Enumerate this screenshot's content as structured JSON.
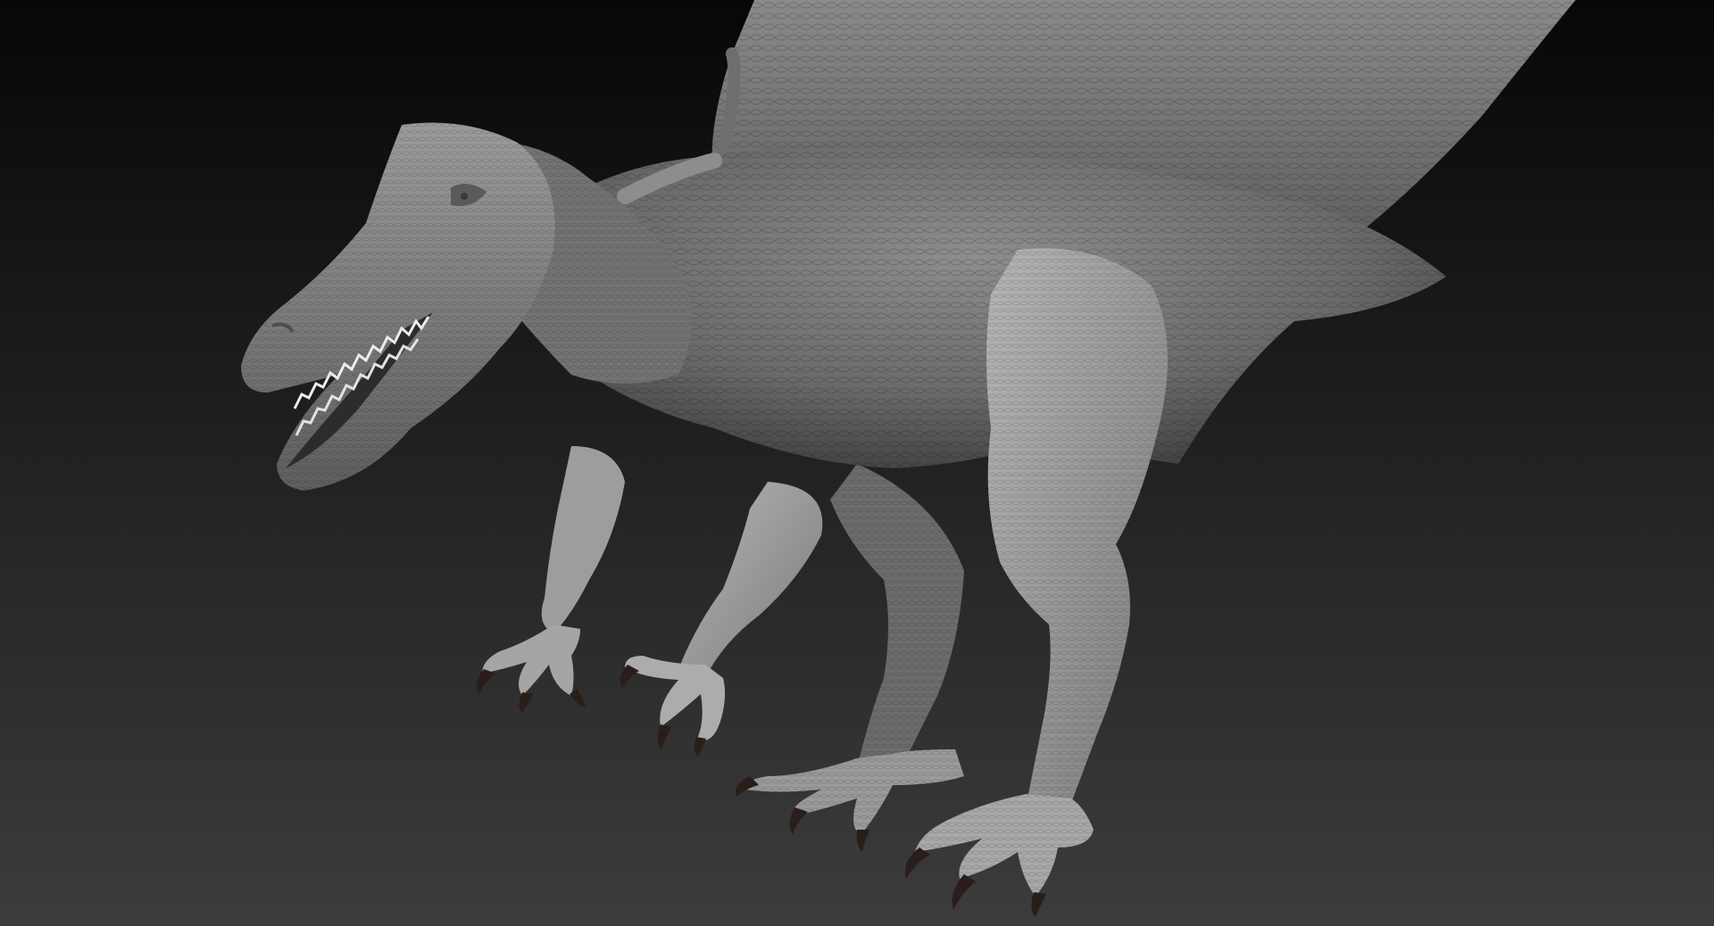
{
  "viewport": {
    "subject": "sculpted-dinosaur-render",
    "colors": {
      "background_top": "#070707",
      "background_bottom": "#3c3c3c",
      "skin_dark": "#4f4f4f",
      "skin_mid": "#747474",
      "skin_light": "#a9a9a9",
      "teeth": "#ececec",
      "claw": "#2a1e1a"
    }
  }
}
